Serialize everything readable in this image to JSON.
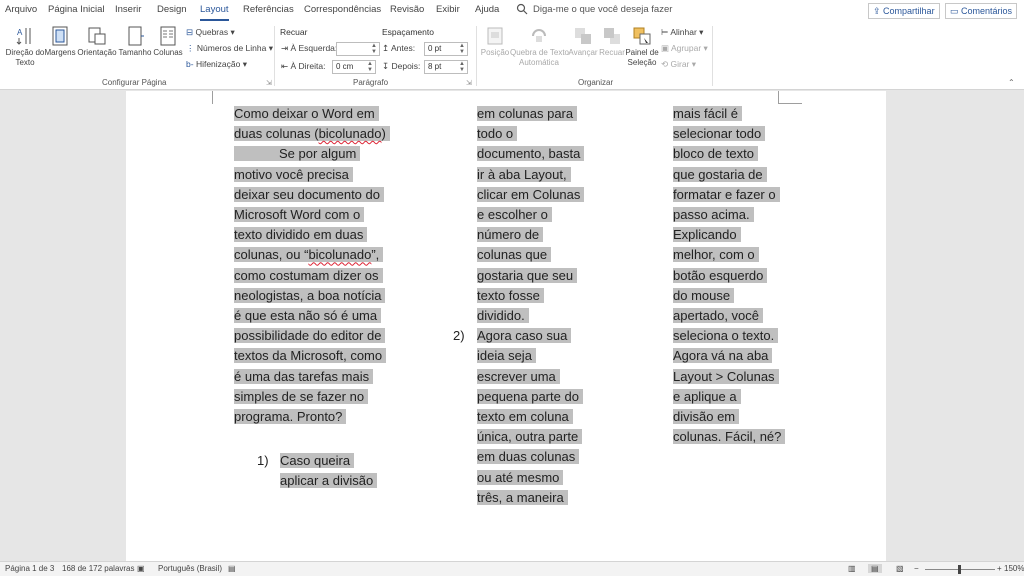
{
  "tabs": [
    "Arquivo",
    "Página Inicial",
    "Inserir",
    "Design",
    "Layout",
    "Referências",
    "Correspondências",
    "Revisão",
    "Exibir",
    "Ajuda"
  ],
  "active_tab": "Layout",
  "tell_me": "Diga-me o que você deseja fazer",
  "share_label": "Compartilhar",
  "comments_label": "Comentários",
  "ribbon": {
    "configurar": {
      "direcao": "Direção do\nTexto",
      "margens": "Margens",
      "orientacao": "Orientação",
      "tamanho": "Tamanho",
      "colunas": "Colunas",
      "quebras": "Quebras",
      "numeros": "Números de Linha",
      "hifenizacao": "Hifenização",
      "group_label": "Configurar Página"
    },
    "paragrafo": {
      "recuar": "Recuar",
      "espacamento": "Espaçamento",
      "esquerda_label": "À Esquerda:",
      "esquerda_value": "",
      "direita_label": "À Direita:",
      "direita_value": "0 cm",
      "antes_label": "Antes:",
      "antes_value": "0 pt",
      "depois_label": "Depois:",
      "depois_value": "8 pt",
      "group_label": "Parágrafo"
    },
    "organizar": {
      "posicao": "Posição",
      "quebra": "Quebra de Texto\nAutomática",
      "avancar": "Avançar",
      "recuar": "Recuar",
      "painel": "Painel de\nSeleção",
      "alinhar": "Alinhar",
      "agrupar": "Agrupar",
      "girar": "Girar",
      "group_label": "Organizar"
    }
  },
  "document": {
    "col1_lines": [
      "Como deixar o Word em",
      "duas colunas (bicolunado)",
      "Se por algum",
      "motivo você precisa",
      "deixar seu documento do",
      "Microsoft Word com o",
      "texto dividido em duas",
      "colunas, ou “bicolunado”,",
      "como costumam dizer os",
      "neologistas, a boa notícia",
      "é que esta não só é uma",
      "possibilidade do editor de",
      "textos da Microsoft, como",
      "é uma das tarefas mais",
      "simples de se fazer no",
      "programa. Pronto?"
    ],
    "item1_number": "1)",
    "item1_lines": [
      "Caso queira",
      "aplicar a divisão"
    ],
    "col2_lines": [
      "em colunas para",
      "todo o",
      "documento, basta",
      "ir à aba Layout,",
      "clicar em Colunas",
      "e escolher o",
      "número de",
      "colunas que",
      "gostaria que seu",
      "texto fosse",
      "dividido."
    ],
    "item2_number": "2)",
    "item2_lines": [
      "Agora caso sua",
      "ideia seja",
      "escrever uma",
      "pequena parte do",
      "texto em coluna",
      "única, outra parte",
      "em duas colunas",
      "ou até mesmo",
      "três, a maneira"
    ],
    "col3_lines": [
      "mais fácil é",
      "selecionar todo",
      "bloco de texto",
      "que gostaria de",
      "formatar e fazer o",
      "passo acima.",
      "Explicando",
      "melhor, com o",
      "botão esquerdo",
      "do mouse",
      "apertado, você",
      "seleciona o texto.",
      "Agora vá na aba",
      "Layout > Colunas",
      "e aplique a",
      "divisão em",
      "colunas. Fácil, né?"
    ]
  },
  "status": {
    "page": "Página 1 de 3",
    "words": "168 de 172 palavras",
    "language": "Português (Brasil)",
    "zoom": "150%"
  }
}
